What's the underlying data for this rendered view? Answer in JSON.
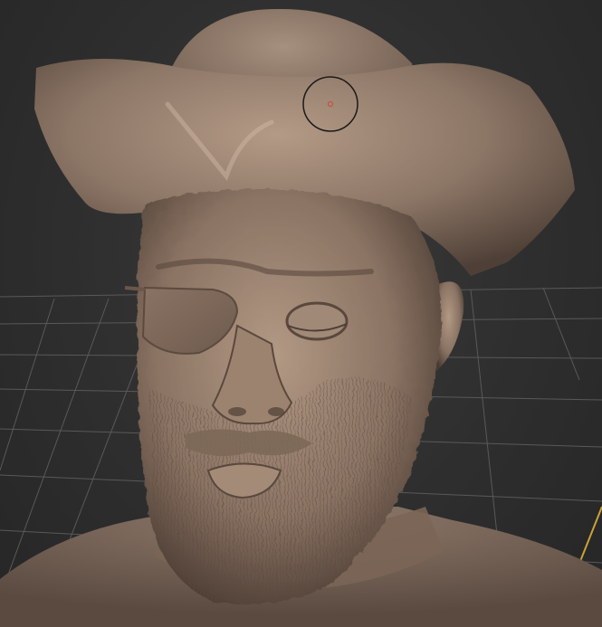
{
  "viewport": {
    "type": "3d-sculpt-viewport",
    "model": "pirate-bust",
    "background_color": "#2f2f2f",
    "grid_color": "#5a5a5a",
    "axis_color": "#c8a23a",
    "clay_color": "#8a7565"
  },
  "brush_cursor": {
    "icon": "brush-circle-cursor"
  }
}
